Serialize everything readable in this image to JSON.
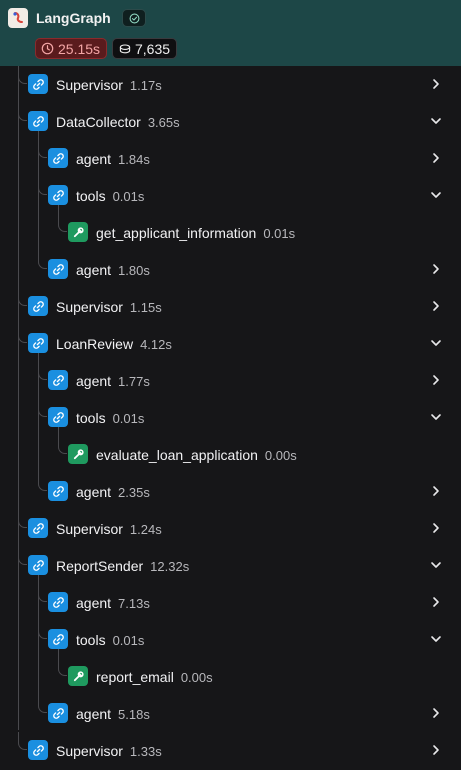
{
  "header": {
    "title": "LangGraph",
    "status_icon": "check-circle-icon",
    "latency": "25.15s",
    "latency_icon": "clock-icon",
    "tokens": "7,635",
    "tokens_icon": "coins-icon"
  },
  "colors": {
    "header_bg": "#1d4747",
    "chain_icon": "#1a8fe0",
    "tool_icon": "#1f9a5f",
    "latency_bg": "#5a1b1d",
    "background": "#161618"
  },
  "tree": [
    {
      "name": "Supervisor",
      "time": "1.17s",
      "icon": "link-icon",
      "state": "collapsed"
    },
    {
      "name": "DataCollector",
      "time": "3.65s",
      "icon": "link-icon",
      "state": "expanded"
    },
    {
      "name": "agent",
      "time": "1.84s",
      "icon": "link-icon",
      "state": "collapsed"
    },
    {
      "name": "tools",
      "time": "0.01s",
      "icon": "link-icon",
      "state": "expanded"
    },
    {
      "name": "get_applicant_information",
      "time": "0.01s",
      "icon": "wrench-icon",
      "state": "leaf"
    },
    {
      "name": "agent",
      "time": "1.80s",
      "icon": "link-icon",
      "state": "collapsed"
    },
    {
      "name": "Supervisor",
      "time": "1.15s",
      "icon": "link-icon",
      "state": "collapsed"
    },
    {
      "name": "LoanReview",
      "time": "4.12s",
      "icon": "link-icon",
      "state": "expanded"
    },
    {
      "name": "agent",
      "time": "1.77s",
      "icon": "link-icon",
      "state": "collapsed"
    },
    {
      "name": "tools",
      "time": "0.01s",
      "icon": "link-icon",
      "state": "expanded"
    },
    {
      "name": "evaluate_loan_application",
      "time": "0.00s",
      "icon": "wrench-icon",
      "state": "leaf"
    },
    {
      "name": "agent",
      "time": "2.35s",
      "icon": "link-icon",
      "state": "collapsed"
    },
    {
      "name": "Supervisor",
      "time": "1.24s",
      "icon": "link-icon",
      "state": "collapsed"
    },
    {
      "name": "ReportSender",
      "time": "12.32s",
      "icon": "link-icon",
      "state": "expanded"
    },
    {
      "name": "agent",
      "time": "7.13s",
      "icon": "link-icon",
      "state": "collapsed"
    },
    {
      "name": "tools",
      "time": "0.01s",
      "icon": "link-icon",
      "state": "expanded"
    },
    {
      "name": "report_email",
      "time": "0.00s",
      "icon": "wrench-icon",
      "state": "leaf"
    },
    {
      "name": "agent",
      "time": "5.18s",
      "icon": "link-icon",
      "state": "collapsed"
    },
    {
      "name": "Supervisor",
      "time": "1.33s",
      "icon": "link-icon",
      "state": "collapsed"
    }
  ]
}
